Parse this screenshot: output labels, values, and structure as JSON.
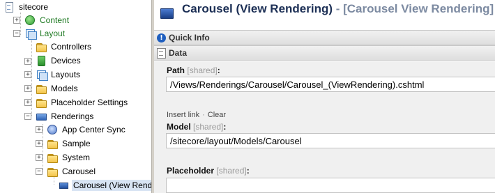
{
  "tree": {
    "root": "sitecore",
    "items": {
      "content": "Content",
      "layout": "Layout",
      "controllers": "Controllers",
      "devices": "Devices",
      "layouts": "Layouts",
      "models": "Models",
      "placeholder_settings": "Placeholder Settings",
      "renderings": "Renderings",
      "app_center_sync": "App Center Sync",
      "sample": "Sample",
      "system": "System",
      "carousel": "Carousel",
      "carousel_view_rendering": "Carousel (View Render"
    },
    "colors": {
      "content_label": "#1f7a23",
      "layout_label": "#1f7a23",
      "selected_bg": "#d8e4f3"
    }
  },
  "editor": {
    "title": "Carousel (View Rendering)",
    "subtitle": " - [Carousel View Rendering]",
    "sections": {
      "quick_info": "Quick Info",
      "data": "Data"
    },
    "fields": {
      "path": {
        "label": "Path",
        "shared": "[shared]",
        "colon": ":",
        "value": "/Views/Renderings/Carousel/Carousel_(ViewRendering).cshtml"
      },
      "model_actions": {
        "insert_link": "Insert link",
        "separator": "·",
        "clear": "Clear"
      },
      "model": {
        "label": "Model",
        "shared": "[shared]",
        "colon": ":",
        "value": "/sitecore/layout/Models/Carousel"
      },
      "placeholder": {
        "label": "Placeholder",
        "shared": "[shared]",
        "colon": ":",
        "value": ""
      }
    },
    "colors": {
      "title": "#1c2f55",
      "subtitle": "#7c8aa1",
      "content_bg": "#f0f0f0"
    }
  }
}
